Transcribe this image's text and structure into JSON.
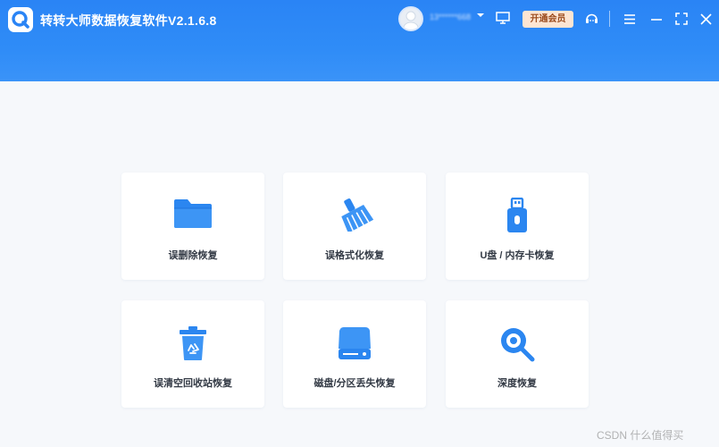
{
  "app": {
    "title": "转转大师数据恢复软件V2.1.6.8"
  },
  "header": {
    "username": "13******668",
    "vip_label": "开通会员",
    "icons": [
      "monitor-icon",
      "support-icon",
      "menu-icon",
      "minimize-icon",
      "maximize-icon",
      "close-icon"
    ]
  },
  "cards": [
    {
      "label": "误删除恢复",
      "icon": "folder-icon"
    },
    {
      "label": "误格式化恢复",
      "icon": "broom-icon"
    },
    {
      "label": "U盘 / 内存卡恢复",
      "icon": "usb-drive-icon"
    },
    {
      "label": "误清空回收站恢复",
      "icon": "recycle-bin-icon"
    },
    {
      "label": "磁盘/分区丢失恢复",
      "icon": "hard-disk-icon"
    },
    {
      "label": "深度恢复",
      "icon": "deep-scan-icon"
    }
  ],
  "watermark": "CSDN 什么值得买",
  "colors": {
    "accent": "#2a84f5",
    "icon": "#2b86f0",
    "vip_bg": "#fde5d3"
  }
}
